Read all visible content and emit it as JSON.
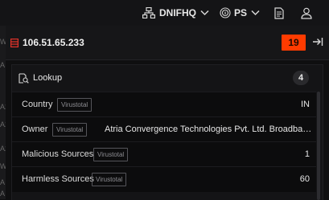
{
  "topbar": {
    "org_label": "DNIFHQ",
    "user_label": "PS"
  },
  "left_strip": {
    "fragments": [
      "W",
      "A",
      "A2",
      "A2",
      "A2",
      "W",
      "A",
      "A"
    ]
  },
  "header": {
    "ip": "106.51.65.233",
    "count": "19",
    "accent_color": "#ff3b00"
  },
  "lookup": {
    "title": "Lookup",
    "count": "4",
    "rows": [
      {
        "label": "Country",
        "source": "Virustotal",
        "value": "IN"
      },
      {
        "label": "Owner",
        "source": "Virustotal",
        "value": "Atria Convergence Technologies Pvt. Ltd. Broadband Intern..."
      },
      {
        "label": "Malicious Sources",
        "source": "Virustotal",
        "value": "1"
      },
      {
        "label": "Harmless Sources",
        "source": "Virustotal",
        "value": "60"
      }
    ]
  }
}
